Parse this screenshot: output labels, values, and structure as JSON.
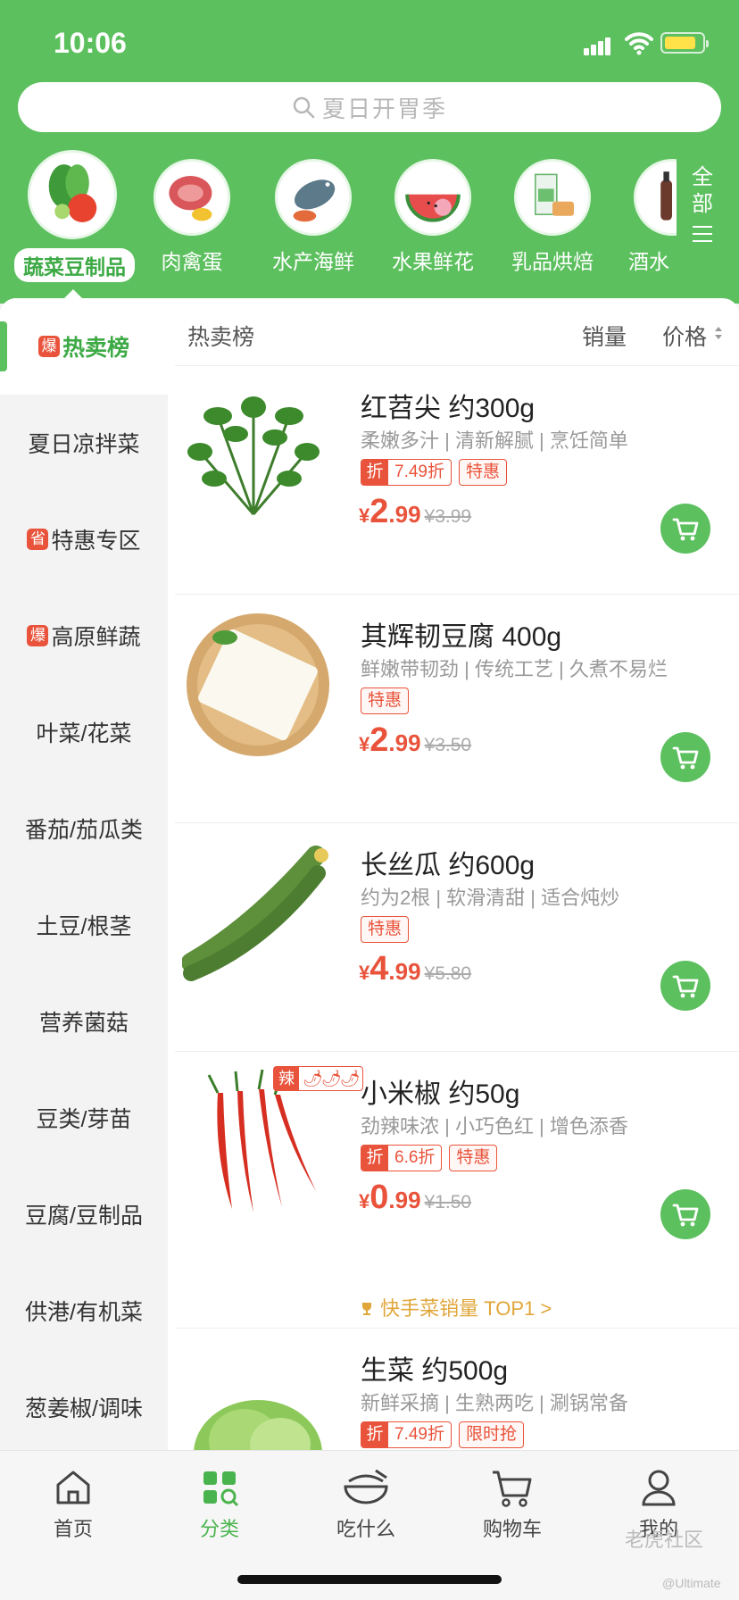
{
  "status": {
    "time": "10:06"
  },
  "search": {
    "placeholder": "夏日开胃季"
  },
  "categories": [
    {
      "label": "蔬菜豆制品",
      "active": true
    },
    {
      "label": "肉禽蛋"
    },
    {
      "label": "水产海鲜"
    },
    {
      "label": "水果鲜花"
    },
    {
      "label": "乳品烘焙"
    },
    {
      "label": "酒水"
    }
  ],
  "all_categories": {
    "line1": "全",
    "line2": "部"
  },
  "sidebar": {
    "items": [
      {
        "label": "热卖榜",
        "badge": "爆",
        "active": true
      },
      {
        "label": "夏日凉拌菜"
      },
      {
        "label": "特惠专区",
        "badge": "省"
      },
      {
        "label": "高原鲜蔬",
        "badge": "爆"
      },
      {
        "label": "叶菜/花菜"
      },
      {
        "label": "番茄/茄瓜类"
      },
      {
        "label": "土豆/根茎"
      },
      {
        "label": "营养菌菇"
      },
      {
        "label": "豆类/芽苗"
      },
      {
        "label": "豆腐/豆制品"
      },
      {
        "label": "供港/有机菜"
      },
      {
        "label": "葱姜椒/调味"
      }
    ]
  },
  "toolbar": {
    "title": "热卖榜",
    "sort_sales": "销量",
    "sort_price": "价格"
  },
  "products": [
    {
      "name": "红苕尖 约300g",
      "desc": "柔嫩多汁 | 清新解腻 | 烹饪简单",
      "discount": "7.49折",
      "tags": [
        "特惠"
      ],
      "price_yen": "¥",
      "price_int": "2",
      "price_dec": ".99",
      "old_price": "¥3.99"
    },
    {
      "name": "其辉韧豆腐 400g",
      "desc": "鲜嫩带韧劲 | 传统工艺 | 久煮不易烂",
      "tags": [
        "特惠"
      ],
      "price_yen": "¥",
      "price_int": "2",
      "price_dec": ".99",
      "old_price": "¥3.50"
    },
    {
      "name": "长丝瓜 约600g",
      "desc": "约为2根 | 软滑清甜 | 适合炖炒",
      "tags": [
        "特惠"
      ],
      "price_yen": "¥",
      "price_int": "4",
      "price_dec": ".99",
      "old_price": "¥5.80"
    },
    {
      "name": "小米椒 约50g",
      "desc": "劲辣味浓 | 小巧色红 | 增色添香",
      "discount": "6.6折",
      "tags": [
        "特惠"
      ],
      "spicy_label": "辣",
      "spicy_icons": "🌶🌶🌶",
      "price_yen": "¥",
      "price_int": "0",
      "price_dec": ".99",
      "old_price": "¥1.50",
      "rank": "快手菜销量 TOP1 >"
    },
    {
      "name": "生菜 约500g",
      "desc": "新鲜采摘 | 生熟两吃 | 涮锅常备",
      "discount": "7.49折",
      "tags": [
        "限时抢"
      ]
    }
  ],
  "discount_mark": "折",
  "tabbar": [
    {
      "label": "首页",
      "icon": "home-icon"
    },
    {
      "label": "分类",
      "icon": "category-icon",
      "active": true
    },
    {
      "label": "吃什么",
      "icon": "bowl-icon"
    },
    {
      "label": "购物车",
      "icon": "cart-icon"
    },
    {
      "label": "我的",
      "icon": "profile-icon"
    }
  ],
  "watermark": {
    "text": "老虎社区",
    "sub": "@Ultimate"
  },
  "colors": {
    "brand_green": "#5dc05f",
    "price_red": "#e9533b",
    "rank_gold": "#e0a63a"
  }
}
